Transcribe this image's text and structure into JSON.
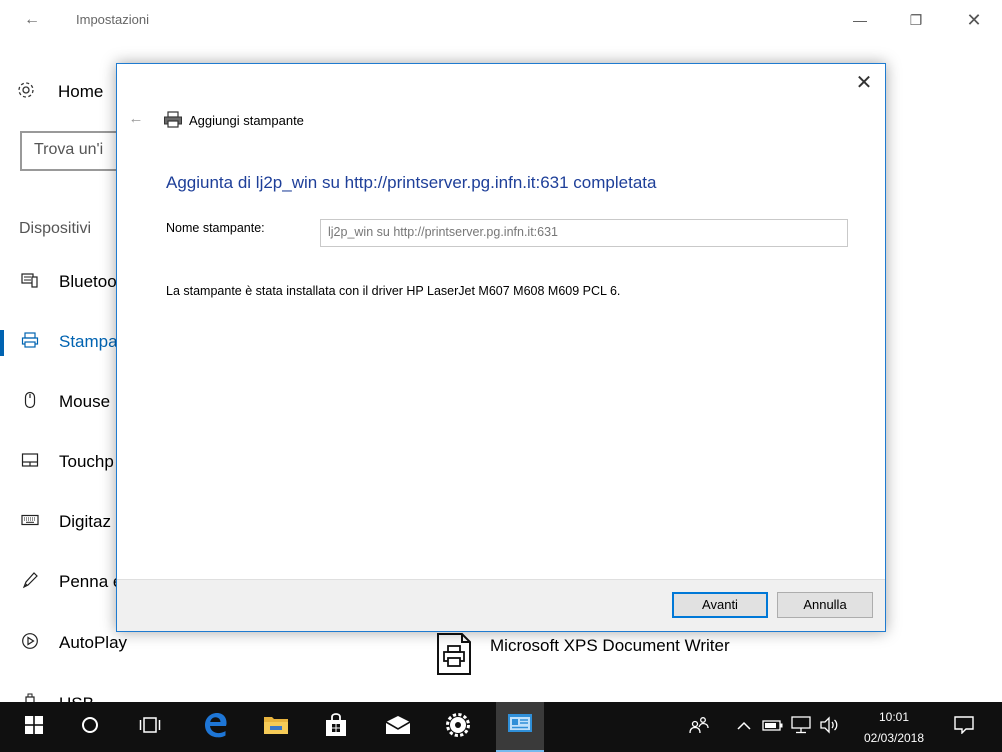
{
  "window": {
    "title": "Impostazioni",
    "back_glyph": "←",
    "minimize_glyph": "—",
    "maximize_glyph": "❐",
    "close_glyph": "✕"
  },
  "sidebar": {
    "home_label": "Home",
    "search_placeholder": "Trova un'i",
    "section_label": "Dispositivi",
    "items": [
      {
        "label": "Bluetoo",
        "icon": "bluetooth-devices-icon",
        "active": false
      },
      {
        "label": "Stampa",
        "icon": "printer-icon",
        "active": true
      },
      {
        "label": "Mouse",
        "icon": "mouse-icon",
        "active": false
      },
      {
        "label": "Touchp",
        "icon": "touchpad-icon",
        "active": false
      },
      {
        "label": "Digitaz",
        "icon": "keyboard-icon",
        "active": false
      },
      {
        "label": "Penna e",
        "icon": "pen-icon",
        "active": false
      },
      {
        "label": "AutoPlay",
        "icon": "autoplay-icon",
        "active": false
      },
      {
        "label": "USB",
        "icon": "usb-icon",
        "active": false
      }
    ]
  },
  "main": {
    "printer_list_item": "Microsoft XPS Document Writer"
  },
  "dialog": {
    "close_glyph": "✕",
    "back_glyph": "←",
    "header_title": "Aggiungi stampante",
    "heading": "Aggiunta di lj2p_win su http://printserver.pg.infn.it:631 completata",
    "name_label": "Nome stampante:",
    "name_value": "lj2p_win su http://printserver.pg.infn.it:631",
    "info_text": "La stampante è stata installata con il driver HP LaserJet M607 M608 M609 PCL 6.",
    "next_button": "Avanti",
    "cancel_button": "Annulla"
  },
  "taskbar": {
    "time": "10:01",
    "date": "02/03/2018",
    "colors": {
      "background": "#101010",
      "edge": "#1e76d6",
      "accent": "#0078d7"
    }
  }
}
